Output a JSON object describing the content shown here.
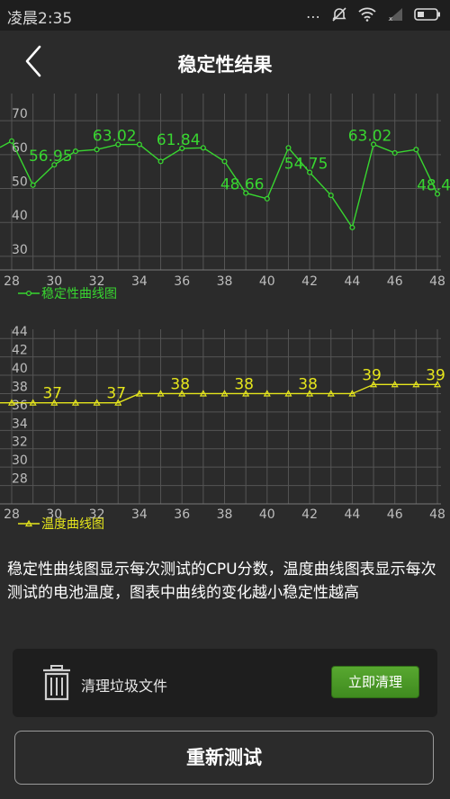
{
  "status_bar": {
    "time": "凌晨2:35",
    "icons": [
      "more-dots-icon",
      "mute-icon",
      "wifi-icon",
      "signal-icon",
      "battery-icon"
    ]
  },
  "header": {
    "title": "稳定性结果",
    "back_icon": "chevron-left-icon"
  },
  "chart_data": [
    {
      "type": "line",
      "title": "",
      "legend": "稳定性曲线图",
      "legend_placement": "bottom-left",
      "color": "#38d630",
      "x": [
        28,
        29,
        30,
        31,
        32,
        33,
        34,
        35,
        36,
        37,
        38,
        39,
        40,
        41,
        42,
        43,
        44,
        45,
        46,
        47,
        48
      ],
      "y": [
        64,
        51,
        57,
        61,
        61.5,
        63,
        63,
        58,
        61.84,
        62,
        58,
        48.66,
        47,
        62,
        54.75,
        48,
        38.5,
        63.02,
        60.5,
        61.5,
        48.4
      ],
      "data_labels": [
        {
          "x": 30,
          "text": "56.95"
        },
        {
          "x": 33,
          "text": "63.02"
        },
        {
          "x": 36,
          "text": "61.84"
        },
        {
          "x": 39,
          "text": "48.66"
        },
        {
          "x": 42,
          "text": "54.75"
        },
        {
          "x": 45,
          "text": "63.02"
        },
        {
          "x": 48,
          "text": "48.4"
        }
      ],
      "xticks": [
        28,
        30,
        32,
        34,
        36,
        38,
        40,
        42,
        44,
        46,
        48
      ],
      "yticks": [
        30,
        40,
        50,
        60,
        70
      ],
      "xlim": [
        28,
        48
      ],
      "ylim": [
        26,
        78
      ],
      "grid": true
    },
    {
      "type": "line",
      "title": "",
      "legend": "温度曲线图",
      "legend_placement": "bottom-left",
      "color": "#e6e61c",
      "x": [
        28,
        29,
        30,
        31,
        32,
        33,
        34,
        35,
        36,
        37,
        38,
        39,
        40,
        41,
        42,
        43,
        44,
        45,
        46,
        47,
        48
      ],
      "y": [
        37,
        37,
        37,
        37,
        37,
        37,
        38,
        38,
        38,
        38,
        38,
        38,
        38,
        38,
        38,
        38,
        38,
        39,
        39,
        39,
        39
      ],
      "data_labels": [
        {
          "x": 30,
          "text": "37"
        },
        {
          "x": 33,
          "text": "37"
        },
        {
          "x": 36,
          "text": "38"
        },
        {
          "x": 39,
          "text": "38"
        },
        {
          "x": 42,
          "text": "38"
        },
        {
          "x": 45,
          "text": "39"
        },
        {
          "x": 48,
          "text": "39"
        }
      ],
      "xticks": [
        28,
        30,
        32,
        34,
        36,
        38,
        40,
        42,
        44,
        46,
        48
      ],
      "yticks": [
        28,
        30,
        32,
        34,
        36,
        38,
        40,
        42,
        44
      ],
      "xlim": [
        28,
        48
      ],
      "ylim": [
        26,
        45
      ],
      "grid": true
    }
  ],
  "description": "稳定性曲线图显示每次测试的CPU分数，温度曲线图表显示每次测试的电池温度，图表中曲线的变化越小稳定性越高",
  "cleanup_card": {
    "icon": "trash-icon",
    "label": "清理垃圾文件",
    "button_label": "立即清理",
    "button_color": "#4a9a26"
  },
  "retest_button": "重新测试"
}
